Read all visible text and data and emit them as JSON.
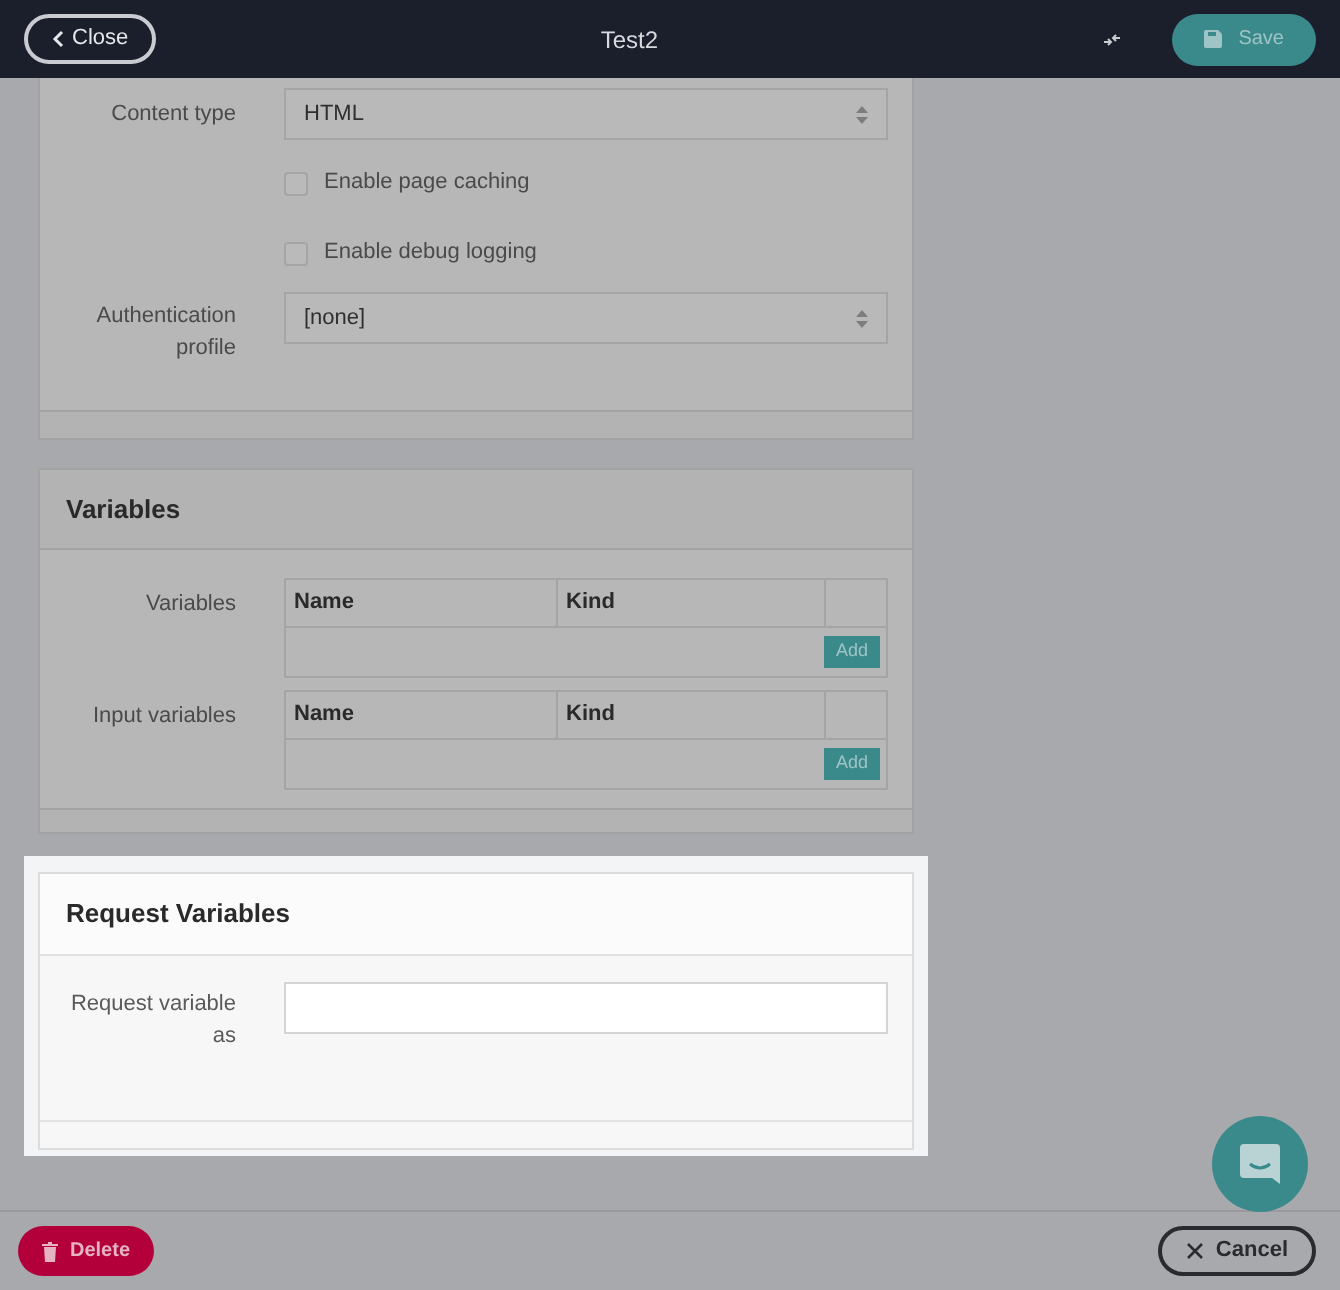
{
  "header": {
    "close_label": "Close",
    "title": "Test2",
    "save_label": "Save"
  },
  "general": {
    "content_type": {
      "label": "Content type",
      "value": "HTML"
    },
    "options": [
      {
        "label": "Enable page caching",
        "checked": false
      },
      {
        "label": "Enable debug logging",
        "checked": false
      }
    ],
    "auth": {
      "label": "Authentication profile",
      "value": "[none]"
    }
  },
  "variables": {
    "title": "Variables",
    "tables": [
      {
        "label": "Variables",
        "columns": [
          "Name",
          "Kind"
        ],
        "add_label": "Add"
      },
      {
        "label": "Input variables",
        "columns": [
          "Name",
          "Kind"
        ],
        "add_label": "Add"
      }
    ]
  },
  "request_variables": {
    "title": "Request Variables",
    "field_label": "Request variable as"
  },
  "footer": {
    "delete_label": "Delete",
    "cancel_label": "Cancel"
  }
}
